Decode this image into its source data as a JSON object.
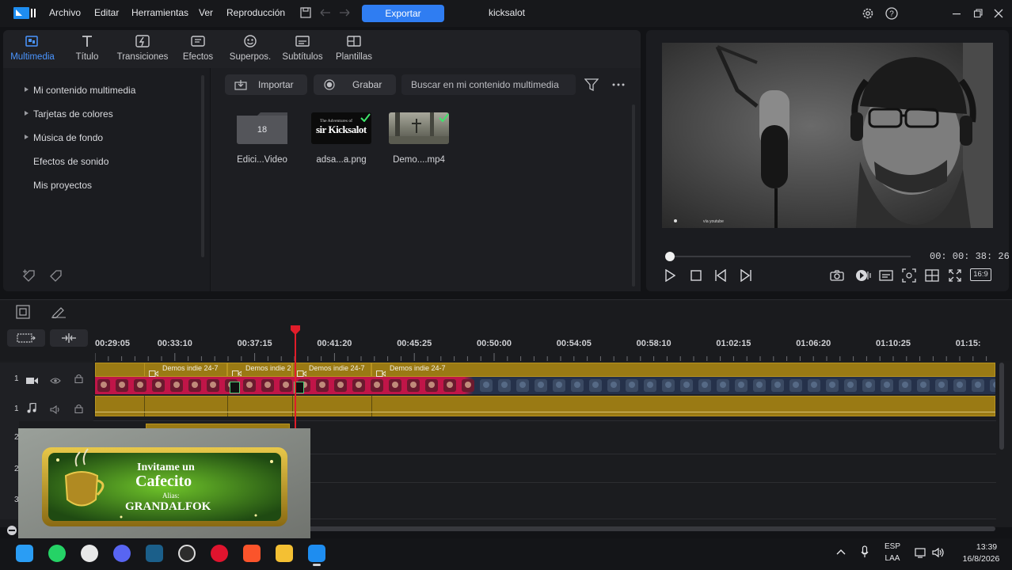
{
  "menubar": {
    "items": [
      "Archivo",
      "Editar",
      "Herramientas",
      "Ver",
      "Reproducción"
    ],
    "export_label": "Exportar",
    "project_title": "kicksalot"
  },
  "tabs": [
    {
      "label": "Multimedia",
      "icon": "media-icon",
      "active": true
    },
    {
      "label": "Título",
      "icon": "title-icon",
      "active": false
    },
    {
      "label": "Transiciones",
      "icon": "transitions-icon",
      "active": false
    },
    {
      "label": "Efectos",
      "icon": "effects-icon",
      "active": false
    },
    {
      "label": "Superpos.",
      "icon": "overlays-icon",
      "active": false
    },
    {
      "label": "Subtítulos",
      "icon": "subtitles-icon",
      "active": false
    },
    {
      "label": "Plantillas",
      "icon": "templates-icon",
      "active": false
    }
  ],
  "sidebar": {
    "items": [
      {
        "label": "Mi contenido multimedia",
        "expandable": true
      },
      {
        "label": "Tarjetas de colores",
        "expandable": true
      },
      {
        "label": "Música de fondo",
        "expandable": true
      },
      {
        "label": "Efectos de sonido",
        "expandable": false
      },
      {
        "label": "Mis proyectos",
        "expandable": false
      }
    ]
  },
  "media": {
    "import_label": "Importar",
    "record_label": "Grabar",
    "search_placeholder": "Buscar en mi contenido multimedia",
    "items": [
      {
        "label": "Edici...Video",
        "type": "folder",
        "count": "18"
      },
      {
        "label": "adsa...a.png",
        "type": "image",
        "thumb_text_top": "The Adventures of",
        "thumb_text_main": "sir Kicksalot"
      },
      {
        "label": "Demo....mp4",
        "type": "video"
      }
    ]
  },
  "preview": {
    "timecode": "00: 00: 38: 26",
    "watermark": "vía youtube",
    "aspect_label": "16:9"
  },
  "ruler": {
    "labels": [
      "00:29:05",
      "00:33:10",
      "00:37:15",
      "00:41:20",
      "00:45:25",
      "00:50:00",
      "00:54:05",
      "00:58:10",
      "01:02:15",
      "01:06:20",
      "01:10:25",
      "01:15:"
    ]
  },
  "tracks": {
    "video_track_num": "1",
    "audio_track_num": "1",
    "extra_track_nums": [
      "2",
      "2",
      "3"
    ],
    "clip_labels": [
      "Demos indie 24-7",
      "Demos indie 2",
      "Demos indie 24-7",
      "Demos indie 24-7"
    ]
  },
  "overlay": {
    "line1": "Invitame un",
    "line2": "Cafecito",
    "line3": "Alias:",
    "line4": "GRANDALFOK"
  },
  "taskbar": {
    "lang1": "ESP",
    "lang2": "LAA",
    "time": "13:39",
    "date": "16/8/2026"
  },
  "colors": {
    "accent": "#2f7df2",
    "clip_gold": "#9a7a14",
    "playhead": "#e01d2a"
  }
}
